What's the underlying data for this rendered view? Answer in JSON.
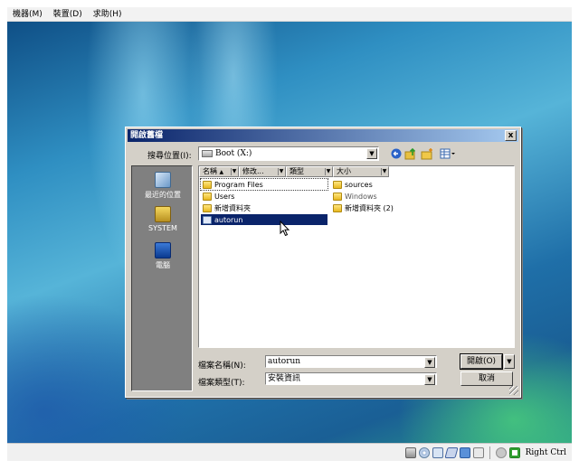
{
  "host": {
    "menu": [
      "機器(M)",
      "裝置(D)",
      "求助(H)"
    ],
    "status": {
      "host_key": "Right Ctrl",
      "icons": [
        "hdd-icon",
        "cd-icon",
        "network-icon",
        "usb-icon",
        "shared-folder-icon",
        "display-icon",
        "record-icon",
        "mouse-capture-icon"
      ]
    }
  },
  "dialog": {
    "title": "開啟舊檔",
    "close": "x",
    "lookin_label": "搜尋位置(I):",
    "lookin_value": "Boot (X:)",
    "places": [
      "最近的位置",
      "SYSTEM",
      "電腦"
    ],
    "columns": [
      "名稱",
      "修改...",
      "類型",
      "大小"
    ],
    "files_left": [
      {
        "name": "Program Files",
        "icon": "folder-icon",
        "focused": true
      },
      {
        "name": "Users",
        "icon": "folder-icon"
      },
      {
        "name": "新增資料夾",
        "icon": "folder-icon"
      },
      {
        "name": "autorun",
        "icon": "setup-info-icon",
        "selected": true
      }
    ],
    "files_right": [
      {
        "name": "sources",
        "icon": "folder-icon"
      },
      {
        "name": "Windows",
        "icon": "folder-icon",
        "greyed": true
      },
      {
        "name": "新增資料夾 (2)",
        "icon": "folder-icon"
      }
    ],
    "filename_label": "檔案名稱(N):",
    "filename_value": "autorun",
    "filetype_label": "檔案類型(T):",
    "filetype_value": "安裝資訊",
    "open_label": "開啟(O)",
    "cancel_label": "取消"
  }
}
